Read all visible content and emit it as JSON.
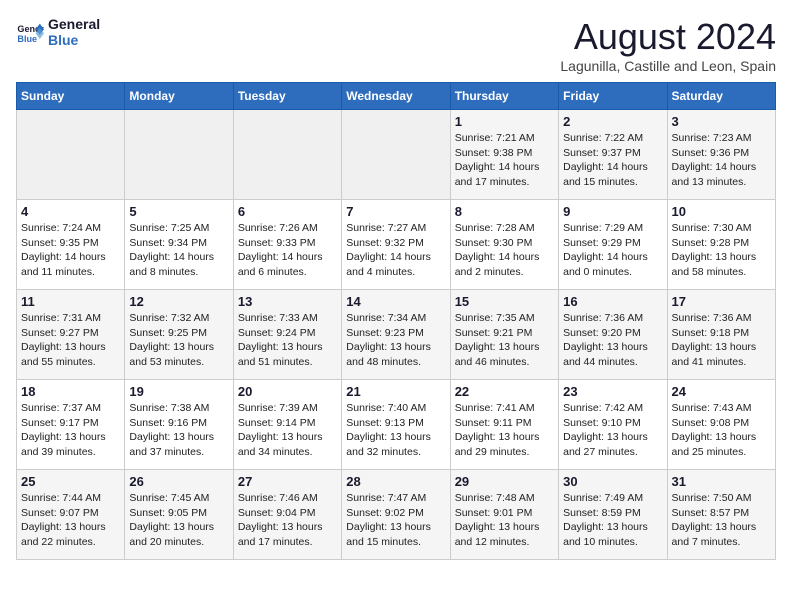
{
  "header": {
    "logo_line1": "General",
    "logo_line2": "Blue",
    "month_year": "August 2024",
    "location": "Lagunilla, Castille and Leon, Spain"
  },
  "weekdays": [
    "Sunday",
    "Monday",
    "Tuesday",
    "Wednesday",
    "Thursday",
    "Friday",
    "Saturday"
  ],
  "weeks": [
    [
      {
        "day": "",
        "info": ""
      },
      {
        "day": "",
        "info": ""
      },
      {
        "day": "",
        "info": ""
      },
      {
        "day": "",
        "info": ""
      },
      {
        "day": "1",
        "info": "Sunrise: 7:21 AM\nSunset: 9:38 PM\nDaylight: 14 hours and 17 minutes."
      },
      {
        "day": "2",
        "info": "Sunrise: 7:22 AM\nSunset: 9:37 PM\nDaylight: 14 hours and 15 minutes."
      },
      {
        "day": "3",
        "info": "Sunrise: 7:23 AM\nSunset: 9:36 PM\nDaylight: 14 hours and 13 minutes."
      }
    ],
    [
      {
        "day": "4",
        "info": "Sunrise: 7:24 AM\nSunset: 9:35 PM\nDaylight: 14 hours and 11 minutes."
      },
      {
        "day": "5",
        "info": "Sunrise: 7:25 AM\nSunset: 9:34 PM\nDaylight: 14 hours and 8 minutes."
      },
      {
        "day": "6",
        "info": "Sunrise: 7:26 AM\nSunset: 9:33 PM\nDaylight: 14 hours and 6 minutes."
      },
      {
        "day": "7",
        "info": "Sunrise: 7:27 AM\nSunset: 9:32 PM\nDaylight: 14 hours and 4 minutes."
      },
      {
        "day": "8",
        "info": "Sunrise: 7:28 AM\nSunset: 9:30 PM\nDaylight: 14 hours and 2 minutes."
      },
      {
        "day": "9",
        "info": "Sunrise: 7:29 AM\nSunset: 9:29 PM\nDaylight: 14 hours and 0 minutes."
      },
      {
        "day": "10",
        "info": "Sunrise: 7:30 AM\nSunset: 9:28 PM\nDaylight: 13 hours and 58 minutes."
      }
    ],
    [
      {
        "day": "11",
        "info": "Sunrise: 7:31 AM\nSunset: 9:27 PM\nDaylight: 13 hours and 55 minutes."
      },
      {
        "day": "12",
        "info": "Sunrise: 7:32 AM\nSunset: 9:25 PM\nDaylight: 13 hours and 53 minutes."
      },
      {
        "day": "13",
        "info": "Sunrise: 7:33 AM\nSunset: 9:24 PM\nDaylight: 13 hours and 51 minutes."
      },
      {
        "day": "14",
        "info": "Sunrise: 7:34 AM\nSunset: 9:23 PM\nDaylight: 13 hours and 48 minutes."
      },
      {
        "day": "15",
        "info": "Sunrise: 7:35 AM\nSunset: 9:21 PM\nDaylight: 13 hours and 46 minutes."
      },
      {
        "day": "16",
        "info": "Sunrise: 7:36 AM\nSunset: 9:20 PM\nDaylight: 13 hours and 44 minutes."
      },
      {
        "day": "17",
        "info": "Sunrise: 7:36 AM\nSunset: 9:18 PM\nDaylight: 13 hours and 41 minutes."
      }
    ],
    [
      {
        "day": "18",
        "info": "Sunrise: 7:37 AM\nSunset: 9:17 PM\nDaylight: 13 hours and 39 minutes."
      },
      {
        "day": "19",
        "info": "Sunrise: 7:38 AM\nSunset: 9:16 PM\nDaylight: 13 hours and 37 minutes."
      },
      {
        "day": "20",
        "info": "Sunrise: 7:39 AM\nSunset: 9:14 PM\nDaylight: 13 hours and 34 minutes."
      },
      {
        "day": "21",
        "info": "Sunrise: 7:40 AM\nSunset: 9:13 PM\nDaylight: 13 hours and 32 minutes."
      },
      {
        "day": "22",
        "info": "Sunrise: 7:41 AM\nSunset: 9:11 PM\nDaylight: 13 hours and 29 minutes."
      },
      {
        "day": "23",
        "info": "Sunrise: 7:42 AM\nSunset: 9:10 PM\nDaylight: 13 hours and 27 minutes."
      },
      {
        "day": "24",
        "info": "Sunrise: 7:43 AM\nSunset: 9:08 PM\nDaylight: 13 hours and 25 minutes."
      }
    ],
    [
      {
        "day": "25",
        "info": "Sunrise: 7:44 AM\nSunset: 9:07 PM\nDaylight: 13 hours and 22 minutes."
      },
      {
        "day": "26",
        "info": "Sunrise: 7:45 AM\nSunset: 9:05 PM\nDaylight: 13 hours and 20 minutes."
      },
      {
        "day": "27",
        "info": "Sunrise: 7:46 AM\nSunset: 9:04 PM\nDaylight: 13 hours and 17 minutes."
      },
      {
        "day": "28",
        "info": "Sunrise: 7:47 AM\nSunset: 9:02 PM\nDaylight: 13 hours and 15 minutes."
      },
      {
        "day": "29",
        "info": "Sunrise: 7:48 AM\nSunset: 9:01 PM\nDaylight: 13 hours and 12 minutes."
      },
      {
        "day": "30",
        "info": "Sunrise: 7:49 AM\nSunset: 8:59 PM\nDaylight: 13 hours and 10 minutes."
      },
      {
        "day": "31",
        "info": "Sunrise: 7:50 AM\nSunset: 8:57 PM\nDaylight: 13 hours and 7 minutes."
      }
    ]
  ]
}
